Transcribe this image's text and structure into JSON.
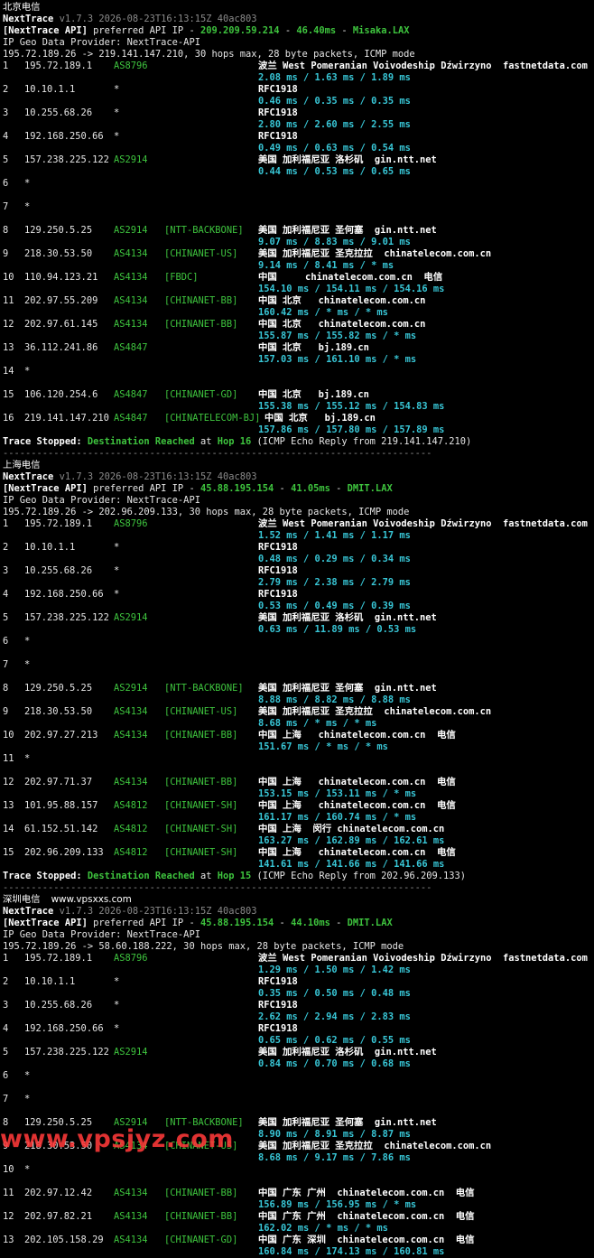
{
  "blocks": [
    {
      "title": "北京电信",
      "site": "",
      "header": {
        "app": "NextTrace",
        "version": "v1.7.3 2026-08-23T16:13:15Z 40ac803",
        "api_label": "[NextTrace API]",
        "api_text": " preferred API IP - ",
        "api_ip": "209.209.59.214",
        "api_ms": "46.40ms",
        "api_pop": "Misaka.LAX",
        "geo_provider": "IP Geo Data Provider: NextTrace-API",
        "route": "195.72.189.26 -> 219.141.147.210, 30 hops max, 28 byte packets, ICMP mode"
      },
      "hops": [
        {
          "no": "1",
          "ip": "195.72.189.1",
          "as": "AS8796",
          "tag": "",
          "geo": "波兰 West Pomeranian Voivodeship Dźwirzyno  fastnetdata.com",
          "rtt": "2.08 ms / 1.63 ms / 1.89 ms"
        },
        {
          "no": "2",
          "ip": "10.10.1.1",
          "as": "*",
          "tag": "",
          "geo": "RFC1918",
          "rtt": "0.46 ms / 0.35 ms / 0.35 ms"
        },
        {
          "no": "3",
          "ip": "10.255.68.26",
          "as": "*",
          "tag": "",
          "geo": "RFC1918",
          "rtt": "2.80 ms / 2.60 ms / 2.55 ms"
        },
        {
          "no": "4",
          "ip": "192.168.250.66",
          "as": "*",
          "tag": "",
          "geo": "RFC1918",
          "rtt": "0.49 ms / 0.63 ms / 0.54 ms"
        },
        {
          "no": "5",
          "ip": "157.238.225.122",
          "as": "AS2914",
          "tag": "",
          "geo": "美国 加利福尼亚 洛杉矶  gin.ntt.net",
          "rtt": "0.44 ms / 0.53 ms / 0.65 ms"
        },
        {
          "no": "6",
          "ip": "*",
          "as": "",
          "tag": "",
          "geo": "",
          "rtt": ""
        },
        {
          "no": "7",
          "ip": "*",
          "as": "",
          "tag": "",
          "geo": "",
          "rtt": ""
        },
        {
          "no": "8",
          "ip": "129.250.5.25",
          "as": "AS2914",
          "tag": "[NTT-BACKBONE]",
          "geo": "美国 加利福尼亚 圣何塞  gin.ntt.net",
          "rtt": "9.07 ms / 8.83 ms / 9.01 ms"
        },
        {
          "no": "9",
          "ip": "218.30.53.50",
          "as": "AS4134",
          "tag": "[CHINANET-US]",
          "geo": "美国 加利福尼亚 圣克拉拉  chinatelecom.com.cn",
          "rtt": "9.14 ms / 8.41 ms / * ms"
        },
        {
          "no": "10",
          "ip": "110.94.123.21",
          "as": "AS4134",
          "tag": "[FBDC]",
          "geo": "中国     chinatelecom.com.cn  电信",
          "rtt": "154.10 ms / 154.11 ms / 154.16 ms"
        },
        {
          "no": "11",
          "ip": "202.97.55.209",
          "as": "AS4134",
          "tag": "[CHINANET-BB]",
          "geo": "中国 北京   chinatelecom.com.cn",
          "rtt": "160.42 ms / * ms / * ms"
        },
        {
          "no": "12",
          "ip": "202.97.61.145",
          "as": "AS4134",
          "tag": "[CHINANET-BB]",
          "geo": "中国 北京   chinatelecom.com.cn",
          "rtt": "155.87 ms / 155.82 ms / * ms"
        },
        {
          "no": "13",
          "ip": "36.112.241.86",
          "as": "AS4847",
          "tag": "",
          "geo": "中国 北京   bj.189.cn",
          "rtt": "157.03 ms / 161.10 ms / * ms"
        },
        {
          "no": "14",
          "ip": "*",
          "as": "",
          "tag": "",
          "geo": "",
          "rtt": ""
        },
        {
          "no": "15",
          "ip": "106.120.254.6",
          "as": "AS4847",
          "tag": "[CHINANET-GD]",
          "geo": "中国 北京   bj.189.cn",
          "rtt": "155.38 ms / 155.12 ms / 154.83 ms"
        },
        {
          "no": "16",
          "ip": "219.141.147.210",
          "as": "AS4847",
          "tag": "[CHINATELECOM-BJ]",
          "geo": "中国 北京   bj.189.cn",
          "rtt": "157.86 ms / 157.80 ms / 157.89 ms"
        }
      ],
      "stop": {
        "label": "Trace Stopped:",
        "reached": "Destination Reached",
        "at": " at ",
        "hop": "Hop 16",
        "detail": " (ICMP Echo Reply from 219.141.147.210)"
      }
    },
    {
      "title": "上海电信",
      "site": "",
      "header": {
        "app": "NextTrace",
        "version": "v1.7.3 2026-08-23T16:13:15Z 40ac803",
        "api_label": "[NextTrace API]",
        "api_text": " preferred API IP - ",
        "api_ip": "45.88.195.154",
        "api_ms": "41.05ms",
        "api_pop": "DMIT.LAX",
        "geo_provider": "IP Geo Data Provider: NextTrace-API",
        "route": "195.72.189.26 -> 202.96.209.133, 30 hops max, 28 byte packets, ICMP mode"
      },
      "hops": [
        {
          "no": "1",
          "ip": "195.72.189.1",
          "as": "AS8796",
          "tag": "",
          "geo": "波兰 West Pomeranian Voivodeship Dźwirzyno  fastnetdata.com",
          "rtt": "1.52 ms / 1.41 ms / 1.17 ms"
        },
        {
          "no": "2",
          "ip": "10.10.1.1",
          "as": "*",
          "tag": "",
          "geo": "RFC1918",
          "rtt": "0.48 ms / 0.29 ms / 0.34 ms"
        },
        {
          "no": "3",
          "ip": "10.255.68.26",
          "as": "*",
          "tag": "",
          "geo": "RFC1918",
          "rtt": "2.79 ms / 2.38 ms / 2.79 ms"
        },
        {
          "no": "4",
          "ip": "192.168.250.66",
          "as": "*",
          "tag": "",
          "geo": "RFC1918",
          "rtt": "0.53 ms / 0.49 ms / 0.39 ms"
        },
        {
          "no": "5",
          "ip": "157.238.225.122",
          "as": "AS2914",
          "tag": "",
          "geo": "美国 加利福尼亚 洛杉矶  gin.ntt.net",
          "rtt": "0.63 ms / 11.89 ms / 0.53 ms"
        },
        {
          "no": "6",
          "ip": "*",
          "as": "",
          "tag": "",
          "geo": "",
          "rtt": ""
        },
        {
          "no": "7",
          "ip": "*",
          "as": "",
          "tag": "",
          "geo": "",
          "rtt": ""
        },
        {
          "no": "8",
          "ip": "129.250.5.25",
          "as": "AS2914",
          "tag": "[NTT-BACKBONE]",
          "geo": "美国 加利福尼亚 圣何塞  gin.ntt.net",
          "rtt": "8.88 ms / 8.82 ms / 8.88 ms"
        },
        {
          "no": "9",
          "ip": "218.30.53.50",
          "as": "AS4134",
          "tag": "[CHINANET-US]",
          "geo": "美国 加利福尼亚 圣克拉拉  chinatelecom.com.cn",
          "rtt": "8.68 ms / * ms / * ms"
        },
        {
          "no": "10",
          "ip": "202.97.27.213",
          "as": "AS4134",
          "tag": "[CHINANET-BB]",
          "geo": "中国 上海   chinatelecom.com.cn  电信",
          "rtt": "151.67 ms / * ms / * ms"
        },
        {
          "no": "11",
          "ip": "*",
          "as": "",
          "tag": "",
          "geo": "",
          "rtt": ""
        },
        {
          "no": "12",
          "ip": "202.97.71.37",
          "as": "AS4134",
          "tag": "[CHINANET-BB]",
          "geo": "中国 上海   chinatelecom.com.cn  电信",
          "rtt": "153.15 ms / 153.11 ms / * ms"
        },
        {
          "no": "13",
          "ip": "101.95.88.157",
          "as": "AS4812",
          "tag": "[CHINANET-SH]",
          "geo": "中国 上海   chinatelecom.com.cn  电信",
          "rtt": "161.17 ms / 160.74 ms / * ms"
        },
        {
          "no": "14",
          "ip": "61.152.51.142",
          "as": "AS4812",
          "tag": "[CHINANET-SH]",
          "geo": "中国 上海  闵行 chinatelecom.com.cn",
          "rtt": "163.27 ms / 162.89 ms / 162.61 ms"
        },
        {
          "no": "15",
          "ip": "202.96.209.133",
          "as": "AS4812",
          "tag": "[CHINANET-SH]",
          "geo": "中国 上海   chinatelecom.com.cn  电信",
          "rtt": "141.61 ms / 141.66 ms / 141.66 ms"
        }
      ],
      "stop": {
        "label": "Trace Stopped:",
        "reached": "Destination Reached",
        "at": " at ",
        "hop": "Hop 15",
        "detail": " (ICMP Echo Reply from 202.96.209.133)"
      }
    },
    {
      "title": "深圳电信",
      "site": "www.vpsxxs.com",
      "header": {
        "app": "NextTrace",
        "version": "v1.7.3 2026-08-23T16:13:15Z 40ac803",
        "api_label": "[NextTrace API]",
        "api_text": " preferred API IP - ",
        "api_ip": "45.88.195.154",
        "api_ms": "44.10ms",
        "api_pop": "DMIT.LAX",
        "geo_provider": "IP Geo Data Provider: NextTrace-API",
        "route": "195.72.189.26 -> 58.60.188.222, 30 hops max, 28 byte packets, ICMP mode"
      },
      "hops": [
        {
          "no": "1",
          "ip": "195.72.189.1",
          "as": "AS8796",
          "tag": "",
          "geo": "波兰 West Pomeranian Voivodeship Dźwirzyno  fastnetdata.com",
          "rtt": "1.29 ms / 1.50 ms / 1.42 ms"
        },
        {
          "no": "2",
          "ip": "10.10.1.1",
          "as": "*",
          "tag": "",
          "geo": "RFC1918",
          "rtt": "0.35 ms / 0.50 ms / 0.48 ms"
        },
        {
          "no": "3",
          "ip": "10.255.68.26",
          "as": "*",
          "tag": "",
          "geo": "RFC1918",
          "rtt": "2.62 ms / 2.94 ms / 2.83 ms"
        },
        {
          "no": "4",
          "ip": "192.168.250.66",
          "as": "*",
          "tag": "",
          "geo": "RFC1918",
          "rtt": "0.65 ms / 0.62 ms / 0.55 ms"
        },
        {
          "no": "5",
          "ip": "157.238.225.122",
          "as": "AS2914",
          "tag": "",
          "geo": "美国 加利福尼亚 洛杉矶  gin.ntt.net",
          "rtt": "0.84 ms / 0.70 ms / 0.68 ms"
        },
        {
          "no": "6",
          "ip": "*",
          "as": "",
          "tag": "",
          "geo": "",
          "rtt": ""
        },
        {
          "no": "7",
          "ip": "*",
          "as": "",
          "tag": "",
          "geo": "",
          "rtt": ""
        },
        {
          "no": "8",
          "ip": "129.250.5.25",
          "as": "AS2914",
          "tag": "[NTT-BACKBONE]",
          "geo": "美国 加利福尼亚 圣何塞  gin.ntt.net",
          "rtt": "8.90 ms / 8.91 ms / 8.87 ms"
        },
        {
          "no": "9",
          "ip": "218.30.53.50",
          "as": "AS4134",
          "tag": "[CHINANET-US]",
          "geo": "美国 加利福尼亚 圣克拉拉  chinatelecom.com.cn",
          "rtt": "8.68 ms / 9.17 ms / 7.86 ms"
        },
        {
          "no": "10",
          "ip": "*",
          "as": "",
          "tag": "",
          "geo": "",
          "rtt": ""
        },
        {
          "no": "11",
          "ip": "202.97.12.42",
          "as": "AS4134",
          "tag": "[CHINANET-BB]",
          "geo": "中国 广东 广州  chinatelecom.com.cn  电信",
          "rtt": "156.89 ms / 156.95 ms / * ms"
        },
        {
          "no": "12",
          "ip": "202.97.82.21",
          "as": "AS4134",
          "tag": "[CHINANET-BB]",
          "geo": "中国 广东 广州  chinatelecom.com.cn  电信",
          "rtt": "162.02 ms / * ms / * ms"
        },
        {
          "no": "13",
          "ip": "202.105.158.29",
          "as": "AS4134",
          "tag": "[CHINANET-GD]",
          "geo": "中国 广东 深圳  chinatelecom.com.cn  电信",
          "rtt": "160.84 ms / 174.13 ms / 160.81 ms"
        }
      ],
      "stop": null
    }
  ],
  "separator": "----------------------------------------------------------------------------",
  "watermark": "www.vpsjyz.com"
}
